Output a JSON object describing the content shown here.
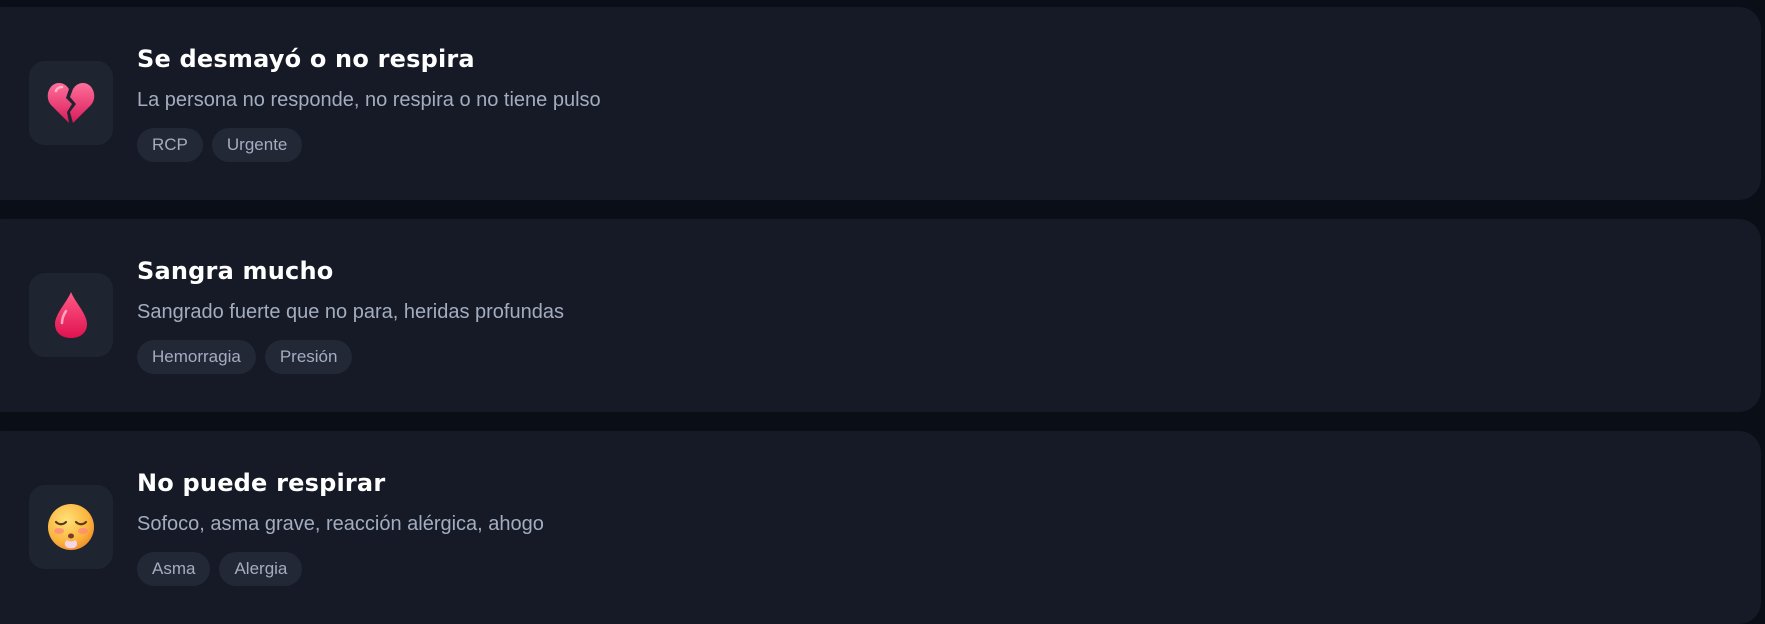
{
  "emergencies": [
    {
      "icon": "broken-heart-icon",
      "title": "Se desmayó o no respira",
      "description": "La persona no responde, no respira o no tiene pulso",
      "tags": [
        "RCP",
        "Urgente"
      ]
    },
    {
      "icon": "blood-drop-icon",
      "title": "Sangra mucho",
      "description": "Sangrado fuerte que no para, heridas profundas",
      "tags": [
        "Hemorragia",
        "Presión"
      ]
    },
    {
      "icon": "exhaling-face-icon",
      "title": "No puede respirar",
      "description": "Sofoco, asma grave, reacción alérgica, ahogo",
      "tags": [
        "Asma",
        "Alergia"
      ]
    }
  ],
  "colors": {
    "background": "#0a0e17",
    "card": "#151a26",
    "icon_tile": "#1f2431",
    "tag": "#232836",
    "title": "#ffffff",
    "muted_text": "#a3adbf",
    "accent_pink": "#f0336b"
  }
}
